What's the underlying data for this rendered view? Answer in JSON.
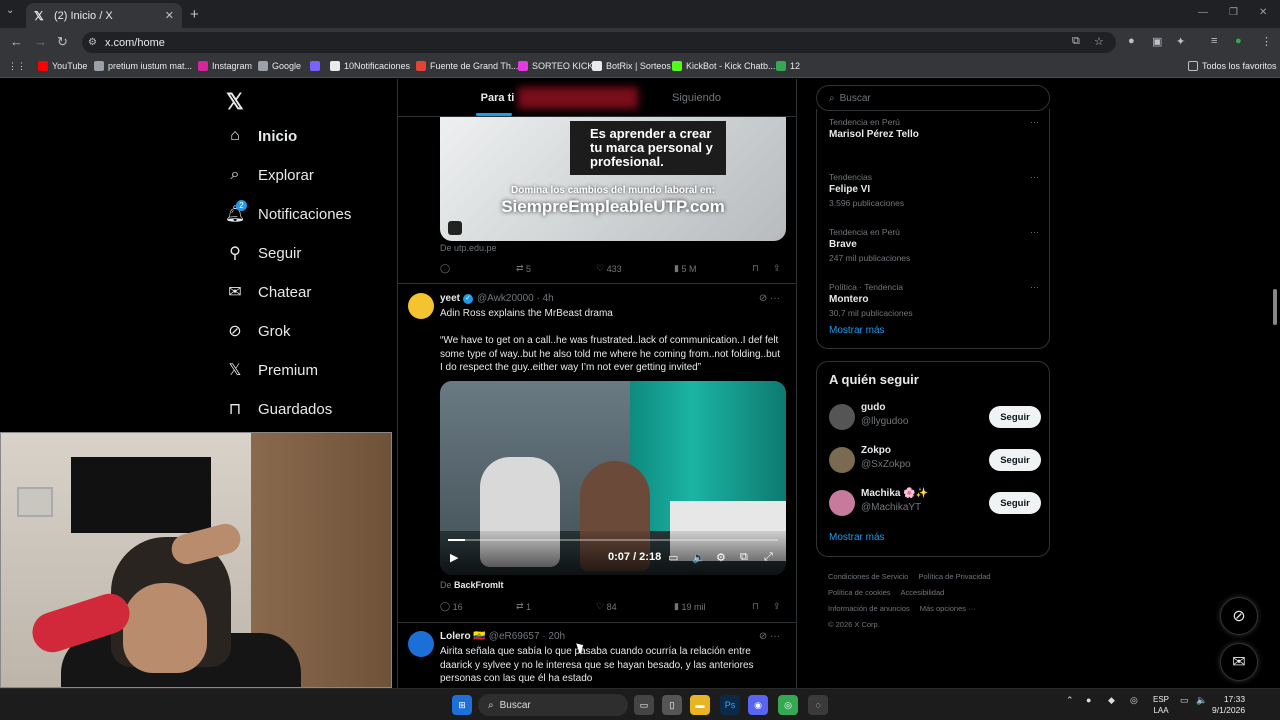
{
  "browser": {
    "tab_title": "(2) Inicio / X",
    "url": "x.com/home",
    "bookmarks": [
      {
        "label": "YouTube",
        "color": "#ff0000"
      },
      {
        "label": "pretium iustum mat...",
        "color": "#9aa0a6"
      },
      {
        "label": "Instagram",
        "color": "#d6249f"
      },
      {
        "label": "Google",
        "color": "#9aa0a6"
      },
      {
        "label": "",
        "color": "#7b61ff"
      },
      {
        "label": "10Notificaciones",
        "color": "#e8eaed"
      },
      {
        "label": "Fuente de Grand Th...",
        "color": "#e34234"
      },
      {
        "label": "SORTEO KICK",
        "color": "#e23ce0"
      },
      {
        "label": "BotRix | Sorteos",
        "color": "#e8eaed"
      },
      {
        "label": "KickBot - Kick Chatb...",
        "color": "#53fc18"
      },
      {
        "label": "12",
        "color": "#34a853"
      }
    ],
    "all_bookmarks": "Todos los favoritos"
  },
  "nav": {
    "items": [
      {
        "label": "Inicio",
        "icon": "home-icon"
      },
      {
        "label": "Explorar",
        "icon": "search-icon"
      },
      {
        "label": "Notificaciones",
        "icon": "bell-icon",
        "badge": "2"
      },
      {
        "label": "Seguir",
        "icon": "add-user-icon"
      },
      {
        "label": "Chatear",
        "icon": "mail-icon"
      },
      {
        "label": "Grok",
        "icon": "grok-icon"
      },
      {
        "label": "Premium",
        "icon": "x-icon"
      },
      {
        "label": "Guardados",
        "icon": "bookmark-icon"
      }
    ]
  },
  "feed": {
    "tabs": [
      "Para ti",
      "Siguiendo"
    ],
    "promo": {
      "box_text": "Es aprender a crear tu marca personal y profesional.",
      "line1": "Domina los cambios del mundo laboral en:",
      "line2": "SiempreEmpleableUTP.com",
      "source": "De utp.edu.pe",
      "retweets": "5",
      "likes": "433",
      "views": "5 M"
    },
    "tweet1": {
      "name": "yeet",
      "handle": "@Awk20000 · 4h",
      "title": "Adin Ross explains the MrBeast drama",
      "body": "“We have to get on a call..he was frustrated..lack of communication..I def felt some type of way..but he also told me where he coming from..not folding..but I do respect the guy..either way I’m not ever getting invited”",
      "video_time": "0:07 / 2:18",
      "video_progress": 0.05,
      "source_prefix": "De",
      "source_name": "BackFromIt",
      "replies": "16",
      "retweets": "1",
      "likes": "84",
      "views": "19 mil"
    },
    "tweet2": {
      "name": "Lolero 🇪🇨",
      "handle": "@eR69657 · 20h",
      "body": "Airita señala que sabía lo que pasaba cuando ocurría la relación entre daarick y sylvee  y no le interesa que se hayan besado, y las anteriores personas con las que él ha  estado"
    }
  },
  "sidebar": {
    "search_placeholder": "Buscar",
    "trends": [
      {
        "context": "Tendencia en Perú",
        "title": "Marisol Pérez Tello",
        "count": ""
      },
      {
        "context": "Tendencias",
        "title": "Felipe VI",
        "count": "3.596 publicaciones"
      },
      {
        "context": "Tendencia en Perú",
        "title": "Brave",
        "count": "247 mil publicaciones"
      },
      {
        "context": "Política · Tendencia",
        "title": "Montero",
        "count": "30,7 mil publicaciones"
      }
    ],
    "show_more": "Mostrar más",
    "who_to_follow": {
      "title": "A quién seguir",
      "users": [
        {
          "name": "gudo",
          "handle": "@llygudoo",
          "button": "Seguir",
          "color": "#555"
        },
        {
          "name": "Zokpo",
          "handle": "@SxZokpo",
          "button": "Seguir",
          "color": "#7a6a52"
        },
        {
          "name": "Machika 🌸✨",
          "handle": "@MachikaYT",
          "button": "Seguir",
          "color": "#c77a9c"
        }
      ],
      "show_more": "Mostrar más"
    },
    "footer": {
      "links": [
        "Condiciones de Servicio",
        "Política de Privacidad",
        "Política de cookies",
        "Accesibilidad",
        "Información de anuncios",
        "Más opciones ···"
      ],
      "copyright": "© 2026 X Corp."
    }
  },
  "taskbar": {
    "search_label": "Buscar",
    "lang_top": "ESP",
    "lang_bottom": "LAA",
    "time": "17:33",
    "date": "9/1/2026"
  }
}
